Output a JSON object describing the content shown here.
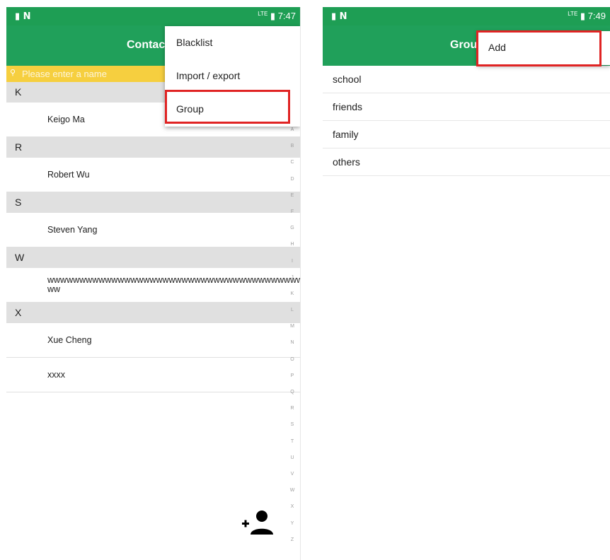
{
  "left_screen": {
    "status_bar": {
      "left_icons": "▮ N",
      "network": "LTE",
      "time": "7:47"
    },
    "app_bar": {
      "title": "Contac"
    },
    "search": {
      "placeholder": "Please enter a name",
      "icon": "search-icon"
    },
    "sections": [
      {
        "letter": "K",
        "contacts": [
          "Keigo Ma"
        ]
      },
      {
        "letter": "R",
        "contacts": [
          "Robert  Wu"
        ]
      },
      {
        "letter": "S",
        "contacts": [
          "Steven Yang"
        ]
      },
      {
        "letter": "W",
        "contacts": [
          "wwwwwwwwwwwwwwwwwwwwwwwwwwwwwwwwwwwwwwww"
        ]
      },
      {
        "letter": "X",
        "contacts": [
          "Xue  Cheng",
          "xxxx"
        ]
      }
    ],
    "w_contact_line2": "ww",
    "index_letters": [
      "A",
      "B",
      "C",
      "D",
      "E",
      "F",
      "G",
      "H",
      "I",
      "J",
      "K",
      "L",
      "M",
      "N",
      "O",
      "P",
      "Q",
      "R",
      "S",
      "T",
      "U",
      "V",
      "W",
      "X",
      "Y",
      "Z"
    ],
    "menu": {
      "items": [
        "Blacklist",
        "Import / export",
        "Group"
      ],
      "highlighted": "Group"
    },
    "fab": {
      "icon": "add-person-icon"
    }
  },
  "right_screen": {
    "status_bar": {
      "left_icons": "▮ N",
      "network": "LTE",
      "time": "7:49"
    },
    "app_bar": {
      "title": "Grou"
    },
    "menu": {
      "items": [
        "Add"
      ],
      "highlighted": "Add"
    },
    "groups": [
      "school",
      "friends",
      "family",
      "others"
    ]
  },
  "colors": {
    "app_green": "#20a05a",
    "search_yellow": "#f6cf3f",
    "highlight_red": "#e02424"
  }
}
